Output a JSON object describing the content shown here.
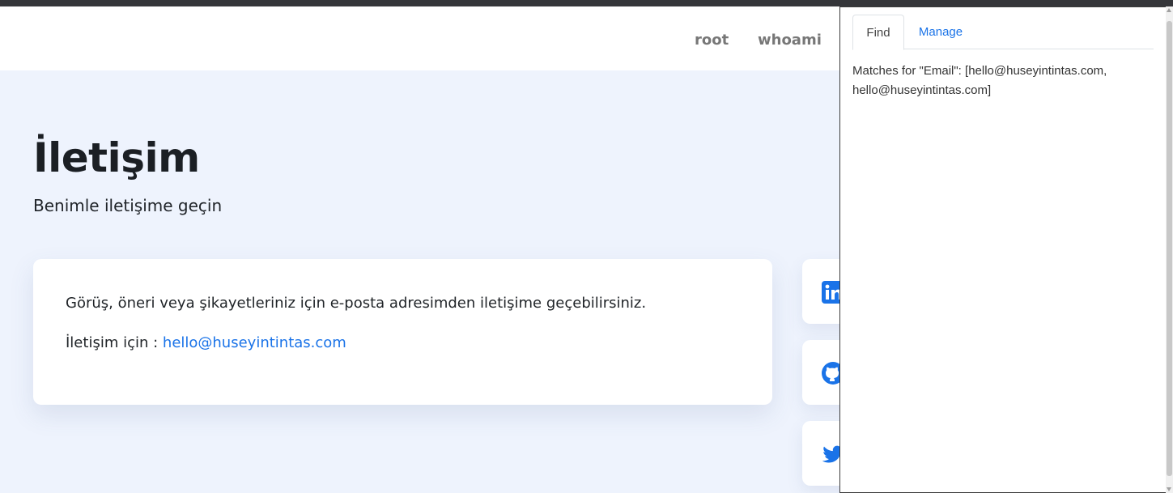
{
  "nav": {
    "links": [
      "root",
      "whoami"
    ]
  },
  "hero": {
    "title": "İletişim",
    "subtitle": "Benimle iletişime geçin"
  },
  "contact_card": {
    "message": "Görüş, öneri veya şikayetleriniz için e-posta adresimden iletişime geçebilirsiniz.",
    "contact_prefix": "İletişim için : ",
    "email": "hello@huseyintintas.com"
  },
  "social": {
    "icons": [
      "linkedin-icon",
      "github-icon",
      "twitter-icon"
    ]
  },
  "extension_panel": {
    "tabs": [
      "Find",
      "Manage"
    ],
    "active_tab": "Find",
    "matches_text": "Matches for \"Email\": [hello@huseyintintas.com, hello@huseyintintas.com]"
  },
  "colors": {
    "page_bg": "#eef3fd",
    "link_blue": "#1a73e8",
    "linkedin": "#0a66c2",
    "github": "#1a73e8",
    "twitter": "#1d9bf0"
  }
}
